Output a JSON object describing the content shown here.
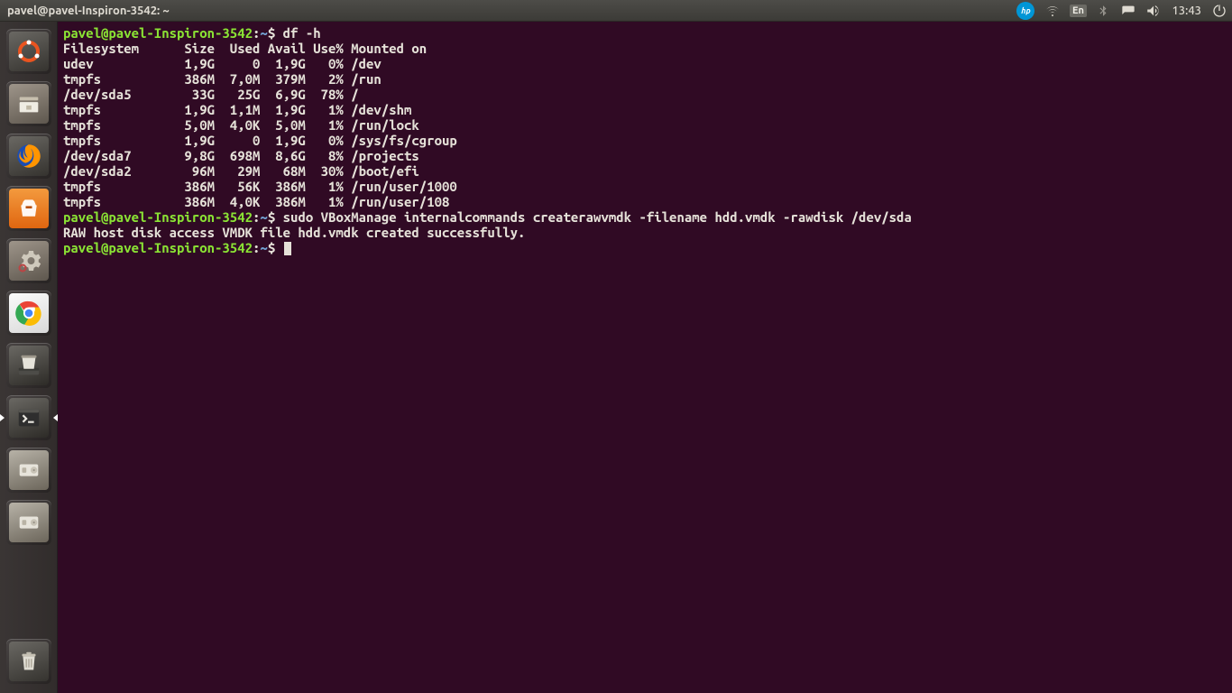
{
  "menubar": {
    "title": "pavel@pavel-Inspiron-3542: ~",
    "time": "13:43",
    "lang": "En"
  },
  "launcher": {
    "items": [
      {
        "name": "dash",
        "bg": "#3c3b37"
      },
      {
        "name": "files",
        "bg": "#3c3b37"
      },
      {
        "name": "firefox",
        "bg": "#3c3b37"
      },
      {
        "name": "software-center",
        "bg": "#3c3b37"
      },
      {
        "name": "settings",
        "bg": "#3c3b37"
      },
      {
        "name": "chrome",
        "bg": "#3c3b37"
      },
      {
        "name": "scanner",
        "bg": "#3c3b37"
      },
      {
        "name": "terminal",
        "bg": "#3c3b37",
        "active": true
      },
      {
        "name": "disk-a",
        "bg": "#3c3b37"
      },
      {
        "name": "disk-b",
        "bg": "#3c3b37"
      }
    ],
    "trash": {
      "name": "trash",
      "bg": "#3c3b37"
    }
  },
  "terminal": {
    "prompt_user": "pavel@pavel-Inspiron-3542",
    "prompt_sep": ":",
    "prompt_path": "~",
    "prompt_suffix": "$",
    "commands": [
      "df -h",
      "sudo VBoxManage internalcommands createrawvmdk -filename hdd.vmdk -rawdisk /dev/sda",
      ""
    ],
    "df_header": "Filesystem      Size  Used Avail Use% Mounted on",
    "df_rows": [
      {
        "fs": "udev",
        "size": "1,9G",
        "used": "0",
        "avail": "1,9G",
        "usep": "0%",
        "mnt": "/dev"
      },
      {
        "fs": "tmpfs",
        "size": "386M",
        "used": "7,0M",
        "avail": "379M",
        "usep": "2%",
        "mnt": "/run"
      },
      {
        "fs": "/dev/sda5",
        "size": "33G",
        "used": "25G",
        "avail": "6,9G",
        "usep": "78%",
        "mnt": "/"
      },
      {
        "fs": "tmpfs",
        "size": "1,9G",
        "used": "1,1M",
        "avail": "1,9G",
        "usep": "1%",
        "mnt": "/dev/shm"
      },
      {
        "fs": "tmpfs",
        "size": "5,0M",
        "used": "4,0K",
        "avail": "5,0M",
        "usep": "1%",
        "mnt": "/run/lock"
      },
      {
        "fs": "tmpfs",
        "size": "1,9G",
        "used": "0",
        "avail": "1,9G",
        "usep": "0%",
        "mnt": "/sys/fs/cgroup"
      },
      {
        "fs": "/dev/sda7",
        "size": "9,8G",
        "used": "698M",
        "avail": "8,6G",
        "usep": "8%",
        "mnt": "/projects"
      },
      {
        "fs": "/dev/sda2",
        "size": "96M",
        "used": "29M",
        "avail": "68M",
        "usep": "30%",
        "mnt": "/boot/efi"
      },
      {
        "fs": "tmpfs",
        "size": "386M",
        "used": "56K",
        "avail": "386M",
        "usep": "1%",
        "mnt": "/run/user/1000"
      },
      {
        "fs": "tmpfs",
        "size": "386M",
        "used": "4,0K",
        "avail": "386M",
        "usep": "1%",
        "mnt": "/run/user/108"
      }
    ],
    "output_line": "RAW host disk access VMDK file hdd.vmdk created successfully."
  }
}
